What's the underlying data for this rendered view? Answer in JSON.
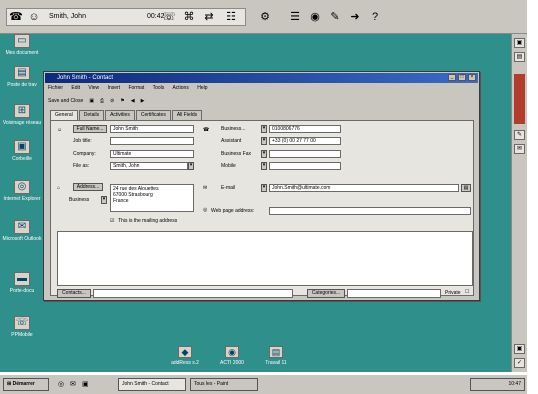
{
  "topbar": {
    "caller_name": "Smith, John",
    "caller_time": "00:42"
  },
  "desktop_icons": [
    {
      "label": "Mes document",
      "icon": "folder-icon"
    },
    {
      "label": "Poste de trav",
      "icon": "computer-icon"
    },
    {
      "label": "Voisinage réseau",
      "icon": "network-icon"
    },
    {
      "label": "Corbeille",
      "icon": "trash-icon"
    },
    {
      "label": "Internet Explorer",
      "icon": "globe-icon"
    },
    {
      "label": "Microsoft Outlook",
      "icon": "mail-icon"
    },
    {
      "label": "Porte-docu",
      "icon": "briefcase-icon"
    },
    {
      "label": "PPMobile",
      "icon": "phone-icon"
    }
  ],
  "bottom_icons": [
    {
      "label": "addRess s.2"
    },
    {
      "label": "ACTI 2000"
    },
    {
      "label": "Travail 11"
    }
  ],
  "window": {
    "title": "John Smith - Contact",
    "menu": [
      "Fichier",
      "Edit",
      "View",
      "Insert",
      "Format",
      "Tools",
      "Actions",
      "Help"
    ],
    "toolbar": {
      "save_close": "Save and Close"
    },
    "tabs": [
      "General",
      "Details",
      "Activities",
      "Certificates",
      "All Fields"
    ],
    "fields": {
      "full_name_btn": "Full Name...",
      "full_name": "John Smith",
      "job_title_label": "Job title:",
      "job_title": "",
      "company_label": "Company:",
      "company": "Ultimate",
      "file_as_label": "File as:",
      "file_as": "Smith, John",
      "business_label": "Business...",
      "business": "0100806776",
      "assistant_label": "Assistant",
      "assistant": "+33 (0) 00 27 77 00",
      "business_fax_label": "Business Fax",
      "business_fax": "",
      "mobile_label": "Mobile",
      "mobile": "",
      "address_btn": "Address...",
      "address_type": "Business",
      "address_lines": [
        "24 rue des Alouettes",
        "67000 Strasbourg",
        "France"
      ],
      "mailing_label": "This is the mailing address",
      "email_label": "E-mail",
      "email": "John.Smith@ultimate.com",
      "webpage_label": "Web page address:",
      "webpage": ""
    },
    "bottom": {
      "contacts_btn": "Contacts...",
      "categories_btn": "Categories...",
      "private_label": "Private"
    }
  },
  "taskbar": {
    "start": "Démarrer",
    "tasks": [
      "John Smith - Contact",
      "Tous les - Paint"
    ],
    "clock": "10:47"
  }
}
